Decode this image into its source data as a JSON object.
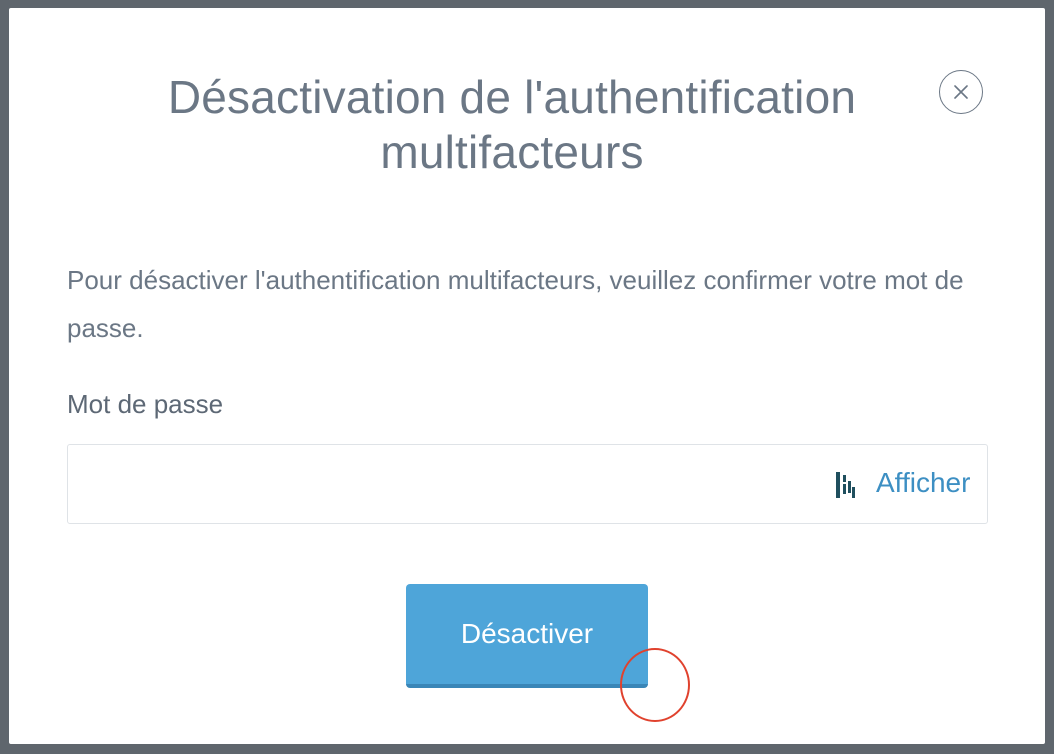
{
  "dialog": {
    "title": "Désactivation de l'authentification multifacteurs",
    "close_icon": "close-icon",
    "description": "Pour désactiver l'authentification multifacteurs, veuillez confirmer votre mot de passe.",
    "password_label": "Mot de passe",
    "password_value": "",
    "password_manager_icon": "dashlane-icon",
    "show_label": "Afficher",
    "submit_label": "Désactiver"
  },
  "colors": {
    "backdrop": "#5f666d",
    "text": "#6b7785",
    "accent": "#4ea5d9",
    "link": "#3d8fc3",
    "cursor_marker": "#e0422e"
  }
}
